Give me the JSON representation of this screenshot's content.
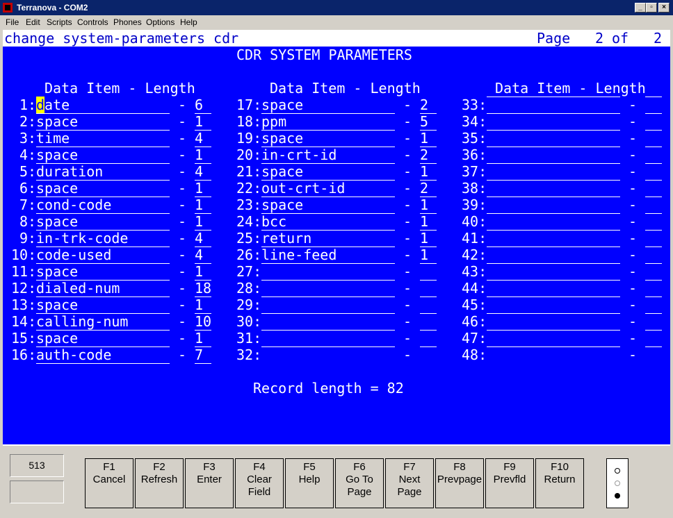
{
  "window": {
    "title": "Terranova - COM2",
    "minimize": "_",
    "maximize": "▫",
    "close": "×"
  },
  "menu": [
    "File",
    "Edit",
    "Scripts",
    "Controls",
    "Phones",
    "Options",
    "Help"
  ],
  "terminal": {
    "command": "change system-parameters cdr",
    "page_label": "Page",
    "page_current": "2",
    "page_of": "of",
    "page_total": "2",
    "heading": "CDR SYSTEM PARAMETERS",
    "col_heading": "Data Item - Length",
    "dash": "-",
    "rows": [
      {
        "num": "1:",
        "item": "date",
        "len": "6"
      },
      {
        "num": "2:",
        "item": "space",
        "len": "1"
      },
      {
        "num": "3:",
        "item": "time",
        "len": "4"
      },
      {
        "num": "4:",
        "item": "space",
        "len": "1"
      },
      {
        "num": "5:",
        "item": "duration",
        "len": "4"
      },
      {
        "num": "6:",
        "item": "space",
        "len": "1"
      },
      {
        "num": "7:",
        "item": "cond-code",
        "len": "1"
      },
      {
        "num": "8:",
        "item": "space",
        "len": "1"
      },
      {
        "num": "9:",
        "item": "in-trk-code",
        "len": "4"
      },
      {
        "num": "10:",
        "item": "code-used",
        "len": "4"
      },
      {
        "num": "11:",
        "item": "space",
        "len": "1"
      },
      {
        "num": "12:",
        "item": "dialed-num",
        "len": "18"
      },
      {
        "num": "13:",
        "item": "space",
        "len": "1"
      },
      {
        "num": "14:",
        "item": "calling-num",
        "len": "10"
      },
      {
        "num": "15:",
        "item": "space",
        "len": "1"
      },
      {
        "num": "16:",
        "item": "auth-code",
        "len": "7"
      },
      {
        "num": "17:",
        "item": "space",
        "len": "2"
      },
      {
        "num": "18:",
        "item": "ppm",
        "len": "5"
      },
      {
        "num": "19:",
        "item": "space",
        "len": "1"
      },
      {
        "num": "20:",
        "item": "in-crt-id",
        "len": "2"
      },
      {
        "num": "21:",
        "item": "space",
        "len": "1"
      },
      {
        "num": "22:",
        "item": "out-crt-id",
        "len": "2"
      },
      {
        "num": "23:",
        "item": "space",
        "len": "1"
      },
      {
        "num": "24:",
        "item": "bcc",
        "len": "1"
      },
      {
        "num": "25:",
        "item": "return",
        "len": "1"
      },
      {
        "num": "26:",
        "item": "line-feed",
        "len": "1"
      },
      {
        "num": "27:",
        "item": "",
        "len": ""
      },
      {
        "num": "28:",
        "item": "",
        "len": ""
      },
      {
        "num": "29:",
        "item": "",
        "len": ""
      },
      {
        "num": "30:",
        "item": "",
        "len": ""
      },
      {
        "num": "31:",
        "item": "",
        "len": ""
      },
      {
        "num": "32:",
        "item": "",
        "len": ""
      },
      {
        "num": "33:",
        "item": "",
        "len": ""
      },
      {
        "num": "34:",
        "item": "",
        "len": ""
      },
      {
        "num": "35:",
        "item": "",
        "len": ""
      },
      {
        "num": "36:",
        "item": "",
        "len": ""
      },
      {
        "num": "37:",
        "item": "",
        "len": ""
      },
      {
        "num": "38:",
        "item": "",
        "len": ""
      },
      {
        "num": "39:",
        "item": "",
        "len": ""
      },
      {
        "num": "40:",
        "item": "",
        "len": ""
      },
      {
        "num": "41:",
        "item": "",
        "len": ""
      },
      {
        "num": "42:",
        "item": "",
        "len": ""
      },
      {
        "num": "43:",
        "item": "",
        "len": ""
      },
      {
        "num": "44:",
        "item": "",
        "len": ""
      },
      {
        "num": "45:",
        "item": "",
        "len": ""
      },
      {
        "num": "46:",
        "item": "",
        "len": ""
      },
      {
        "num": "47:",
        "item": "",
        "len": ""
      },
      {
        "num": "48:",
        "item": "",
        "len": ""
      }
    ],
    "record_length": "Record length = 82"
  },
  "status": {
    "line_number": "513",
    "fkeys": [
      {
        "key": "F1",
        "label": [
          "Cancel"
        ]
      },
      {
        "key": "F2",
        "label": [
          "Refresh"
        ]
      },
      {
        "key": "F3",
        "label": [
          "Enter"
        ]
      },
      {
        "key": "F4",
        "label": [
          "Clear",
          "Field"
        ]
      },
      {
        "key": "F5",
        "label": [
          "Help"
        ]
      },
      {
        "key": "F6",
        "label": [
          "Go To",
          "Page"
        ]
      },
      {
        "key": "F7",
        "label": [
          "Next",
          "Page"
        ]
      },
      {
        "key": "F8",
        "label": [
          "Prevpage"
        ]
      },
      {
        "key": "F9",
        "label": [
          "Prevfld"
        ]
      },
      {
        "key": "F10",
        "label": [
          "Return"
        ]
      }
    ]
  },
  "colors": {
    "screen_bg": "#0000ff",
    "cursor": "#ffff00",
    "titlebar": "#0a246a"
  }
}
